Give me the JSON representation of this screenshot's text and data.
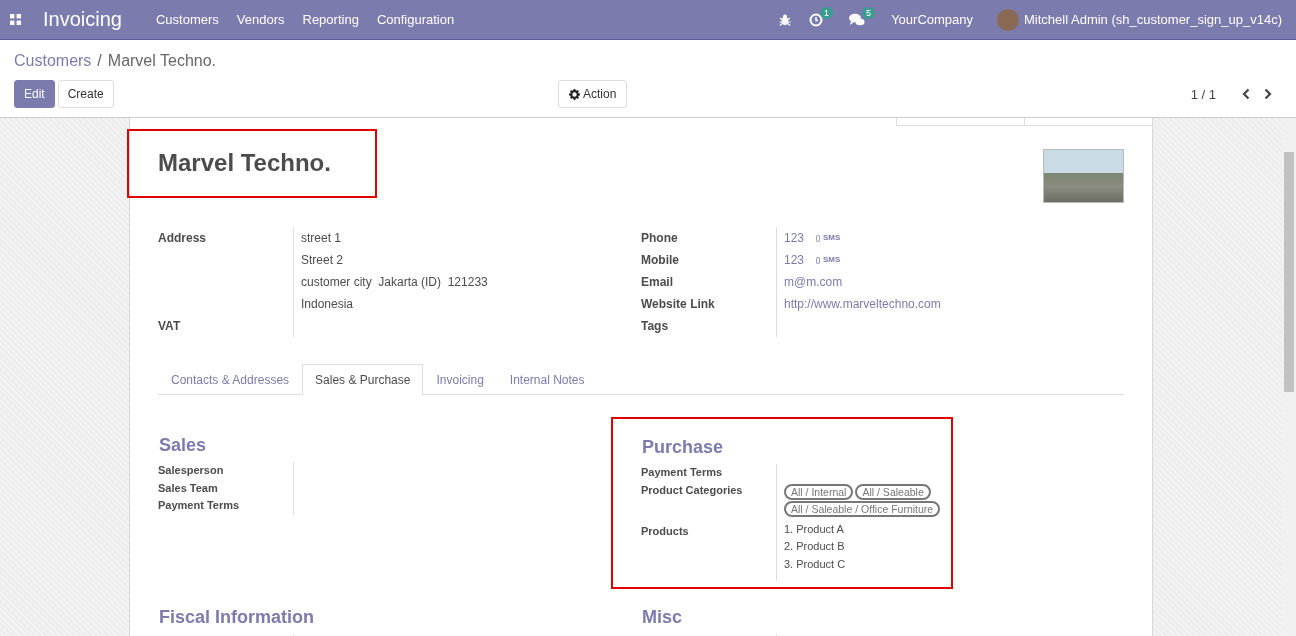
{
  "navbar": {
    "app_name": "Invoicing",
    "menu": [
      "Customers",
      "Vendors",
      "Reporting",
      "Configuration"
    ],
    "activity_count": "1",
    "message_count": "5",
    "company": "YourCompany",
    "user": "Mitchell Admin (sh_customer_sign_up_v14c)"
  },
  "breadcrumb": {
    "parent": "Customers",
    "separator": "/",
    "current": "Marvel Techno."
  },
  "buttons": {
    "edit": "Edit",
    "create": "Create",
    "action": "Action"
  },
  "pager": {
    "value": "1 / 1"
  },
  "record": {
    "name": "Marvel Techno.",
    "left_fields": [
      {
        "label": "Address",
        "lines": [
          "street 1",
          "Street 2",
          "customer city  Jakarta (ID)  121233",
          "Indonesia"
        ]
      },
      {
        "label": "VAT"
      }
    ],
    "right_fields": [
      {
        "label": "Phone",
        "value": "123",
        "sms": "SMS",
        "kind": "link"
      },
      {
        "label": "Mobile",
        "value": "123",
        "sms": "SMS",
        "kind": "link"
      },
      {
        "label": "Email",
        "value": "m@m.com",
        "kind": "link"
      },
      {
        "label": "Website Link",
        "value": "http://www.marveltechno.com",
        "kind": "link"
      },
      {
        "label": "Tags",
        "kind": "empty"
      }
    ]
  },
  "tabs": [
    {
      "label": "Contacts & Addresses",
      "selected": false
    },
    {
      "label": "Sales & Purchase",
      "selected": true
    },
    {
      "label": "Invoicing",
      "selected": false
    },
    {
      "label": "Internal Notes",
      "selected": false
    }
  ],
  "sales": {
    "title": "Sales",
    "fields": [
      "Salesperson",
      "Sales Team",
      "Payment Terms"
    ]
  },
  "purchase": {
    "title": "Purchase",
    "payment_terms_label": "Payment Terms",
    "categories_label": "Product Categories",
    "categories": [
      "All / Internal",
      "All / Saleable",
      "All / Saleable / Office Furniture"
    ],
    "products_label": "Products",
    "products": [
      "1. Product A",
      "2. Product B",
      "3. Product C"
    ]
  },
  "fiscal": {
    "title": "Fiscal Information"
  },
  "misc": {
    "title": "Misc"
  }
}
